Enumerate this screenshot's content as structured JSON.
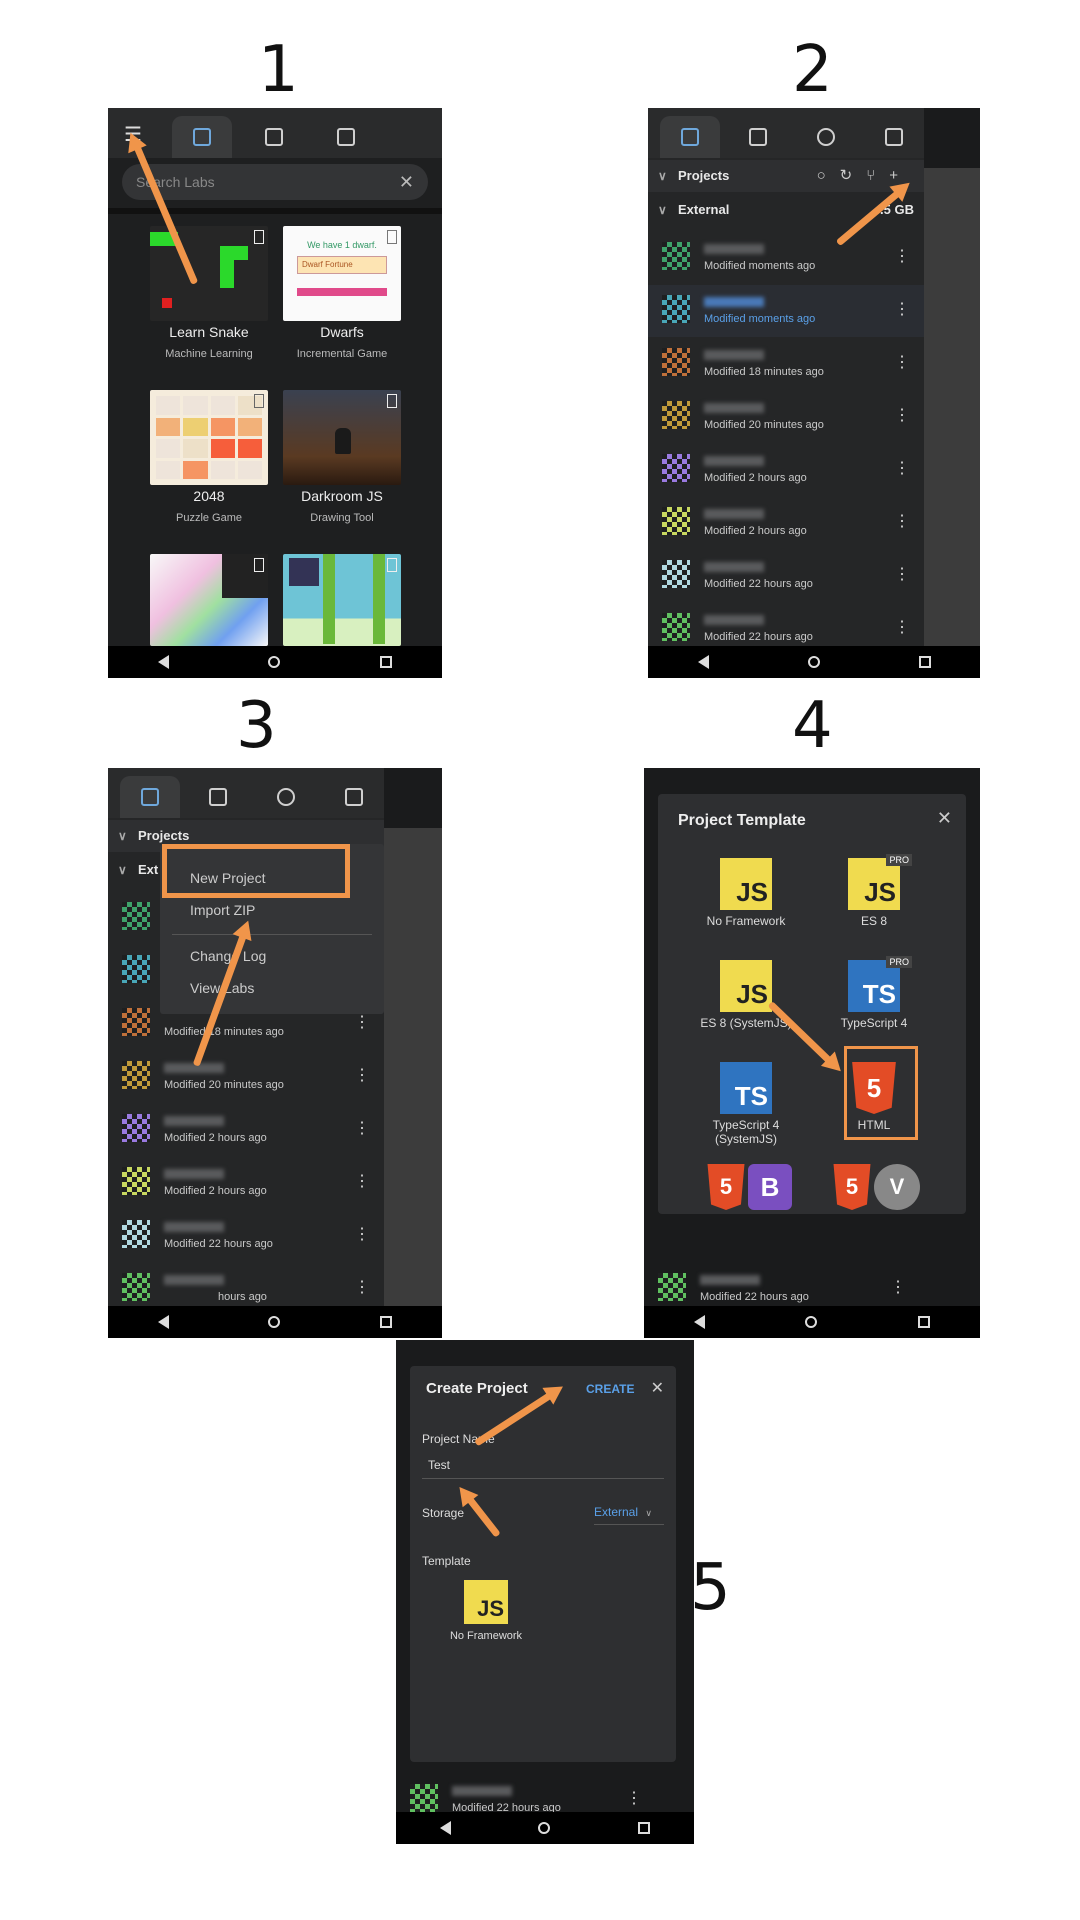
{
  "step_numbers": [
    "1",
    "2",
    "3",
    "4",
    "5"
  ],
  "colors": {
    "accent_arrow": "#f0954a",
    "panel_bg": "#252627",
    "link_blue": "#5aa0e8"
  },
  "panel1": {
    "search_placeholder": "Search Labs",
    "cards": [
      {
        "title": "Learn Snake",
        "subtitle": "Machine Learning"
      },
      {
        "title": "Dwarfs",
        "subtitle": "Incremental Game"
      },
      {
        "title": "2048",
        "subtitle": "Puzzle Game"
      },
      {
        "title": "Darkroom JS",
        "subtitle": "Drawing Tool"
      }
    ],
    "dwarfs_card_text": "We have 1 dwarf.",
    "dwarfs_card_banner": "Dwarf Fortune"
  },
  "panel2": {
    "projects_label": "Projects",
    "external_label": "External",
    "external_size": ".5 GB",
    "rows": [
      {
        "meta": "Modified moments ago"
      },
      {
        "meta": "Modified moments ago",
        "highlight": true
      },
      {
        "meta": "Modified 18 minutes ago"
      },
      {
        "meta": "Modified 20 minutes ago"
      },
      {
        "meta": "Modified 2 hours ago"
      },
      {
        "meta": "Modified 2 hours ago"
      },
      {
        "meta": "Modified 22 hours ago"
      },
      {
        "meta": "Modified 22 hours ago"
      }
    ]
  },
  "panel3": {
    "projects_label": "Projects",
    "external_label": "Ext",
    "menu": {
      "new_project": "New Project",
      "import_zip": "Import ZIP",
      "change_log": "Change Log",
      "view_labs": "View Labs"
    },
    "rows": [
      {
        "meta": "Modified 18 minutes ago"
      },
      {
        "meta": "Modified 20 minutes ago"
      },
      {
        "meta": "Modified 2 hours ago"
      },
      {
        "meta": "Modified 2 hours ago"
      },
      {
        "meta": "Modified 22 hours ago"
      },
      {
        "meta": "hours ago"
      }
    ]
  },
  "panel4": {
    "title": "Project Template",
    "templates": [
      {
        "label": "No Framework",
        "logo": "JS",
        "pro": false
      },
      {
        "label": "ES 8",
        "logo": "JS",
        "pro": true
      },
      {
        "label": "ES 8 (SystemJS)",
        "logo": "JS",
        "pro": false
      },
      {
        "label": "TypeScript 4",
        "logo": "TS",
        "pro": true
      },
      {
        "label": "TypeScript 4 (SystemJS)",
        "logo": "TS",
        "pro": false
      },
      {
        "label": "HTML",
        "logo": "5",
        "pro": false
      }
    ],
    "pro_badge": "PRO",
    "bottom_logos": [
      "5",
      "B",
      "5",
      "V"
    ],
    "footer_meta": "Modified 22 hours ago"
  },
  "panel5": {
    "title": "Create Project",
    "create_label": "CREATE",
    "project_name_label": "Project Name",
    "project_name_value": "Test",
    "storage_label": "Storage",
    "storage_value": "External",
    "template_label": "Template",
    "template_name": "No Framework",
    "template_logo": "JS",
    "footer_meta": "Modified 22 hours ago"
  }
}
